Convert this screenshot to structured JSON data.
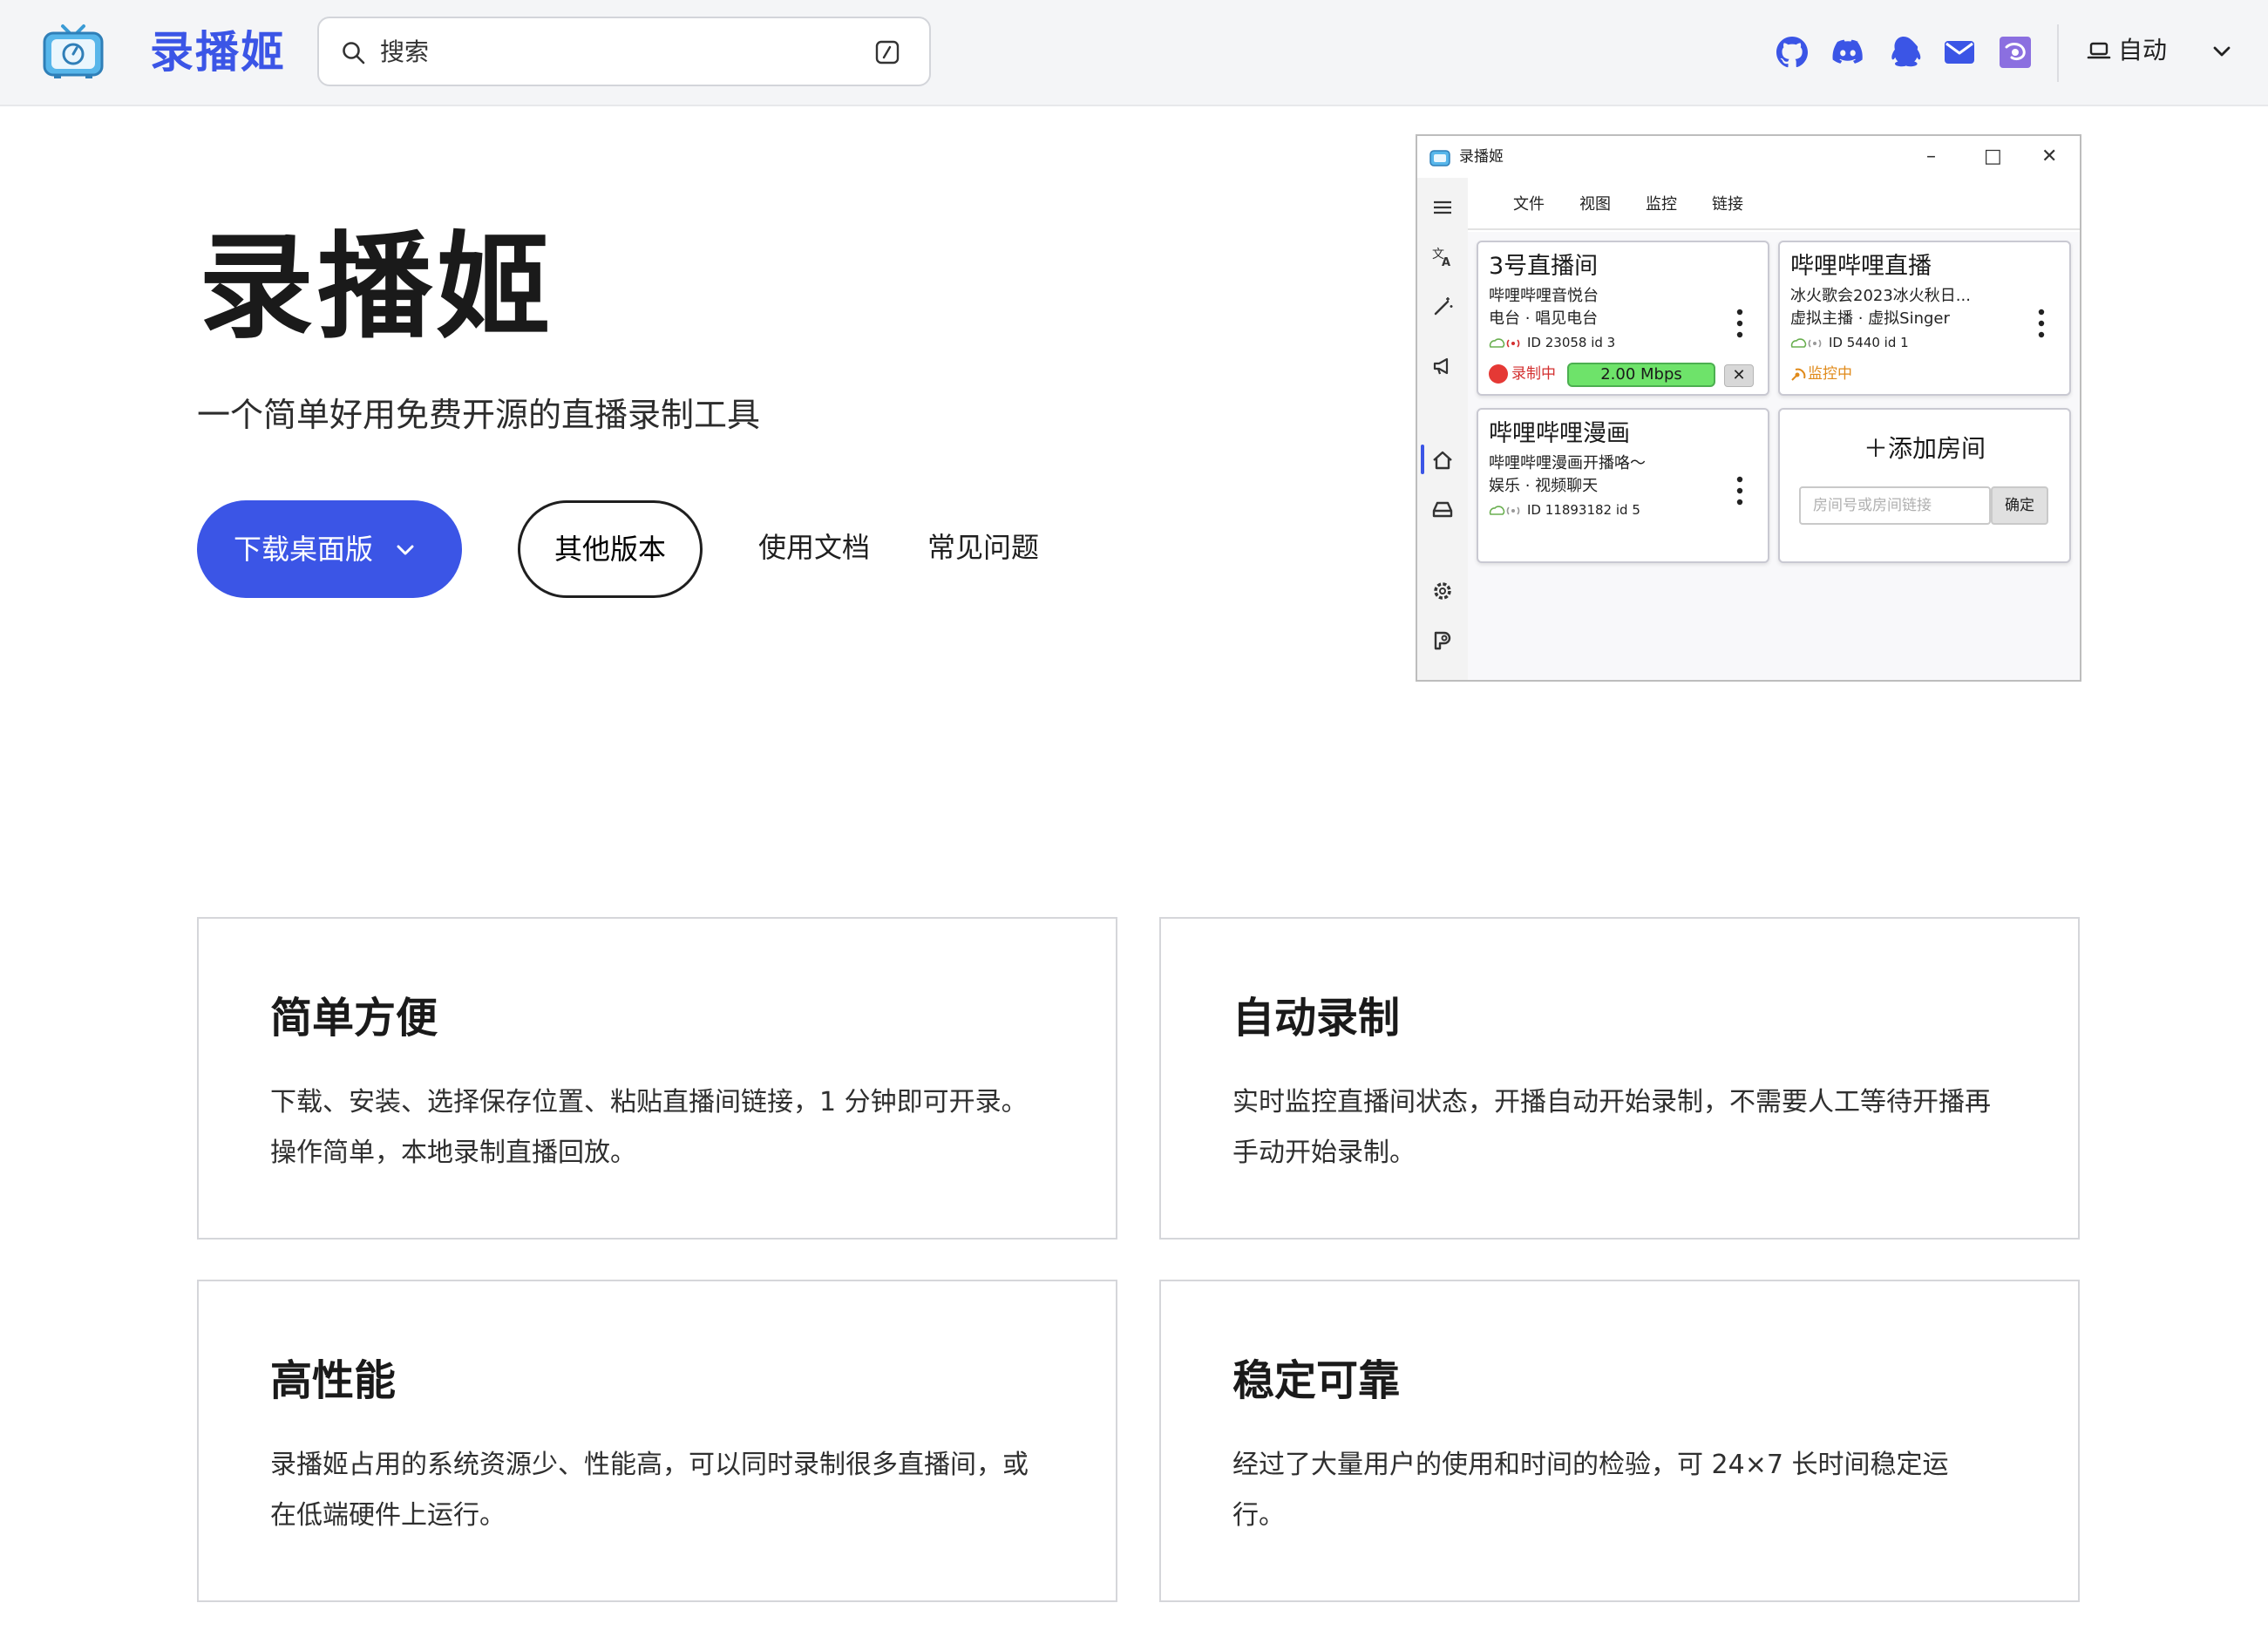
{
  "header": {
    "brand": "录播姬",
    "search_placeholder": "搜索",
    "theme_label": "自动",
    "icons": [
      "github-icon",
      "discord-icon",
      "qq-icon",
      "mail-icon",
      "app-icon"
    ]
  },
  "hero": {
    "title": "录播姬",
    "subtitle": "一个简单好用免费开源的直播录制工具",
    "download_label": "下载桌面版",
    "other_versions_label": "其他版本",
    "docs_label": "使用文档",
    "faq_label": "常见问题"
  },
  "app_window": {
    "title": "录播姬",
    "controls": [
      "–",
      "□",
      "✕"
    ],
    "menu": [
      "文件",
      "视图",
      "监控",
      "链接"
    ],
    "rooms": [
      {
        "title": "3号直播间",
        "line1": "哔哩哔哩音悦台",
        "line2": "电台 · 唱见电台",
        "id_line": "ID 23058  id 3",
        "status": "录制中",
        "speed": "2.00 Mbps",
        "stop": "✕"
      },
      {
        "title": "哔哩哔哩直播",
        "line1": "冰火歌会2023冰火秋日...",
        "line2": "虚拟主播 · 虚拟Singer",
        "id_line": "ID 5440  id 1",
        "status": "监控中"
      },
      {
        "title": "哔哩哔哩漫画",
        "line1": "哔哩哔哩漫画开播咯～",
        "line2": "娱乐 · 视频聊天",
        "id_line": "ID 11893182  id 5"
      }
    ],
    "add_room": {
      "title": "＋添加房间",
      "placeholder": "房间号或房间链接",
      "confirm": "确定"
    }
  },
  "features": [
    {
      "title": "简单方便",
      "desc": "下载、安装、选择保存位置、粘贴直播间链接，1 分钟即可开录。操作简单，本地录制直播回放。"
    },
    {
      "title": "自动录制",
      "desc": "实时监控直播间状态，开播自动开始录制，不需要人工等待开播再手动开始录制。"
    },
    {
      "title": "高性能",
      "desc": "录播姬占用的系统资源少、性能高，可以同时录制很多直播间，或在低端硬件上运行。"
    },
    {
      "title": "稳定可靠",
      "desc": "经过了大量用户的使用和时间的检验，可 24×7 长时间稳定运行。"
    }
  ],
  "colors": {
    "brand": "#3b55e6",
    "topbar_bg": "#f4f5f7",
    "recording_red": "#e53935",
    "speed_green": "#6ee36a",
    "monitor_orange": "#e08a1a"
  }
}
